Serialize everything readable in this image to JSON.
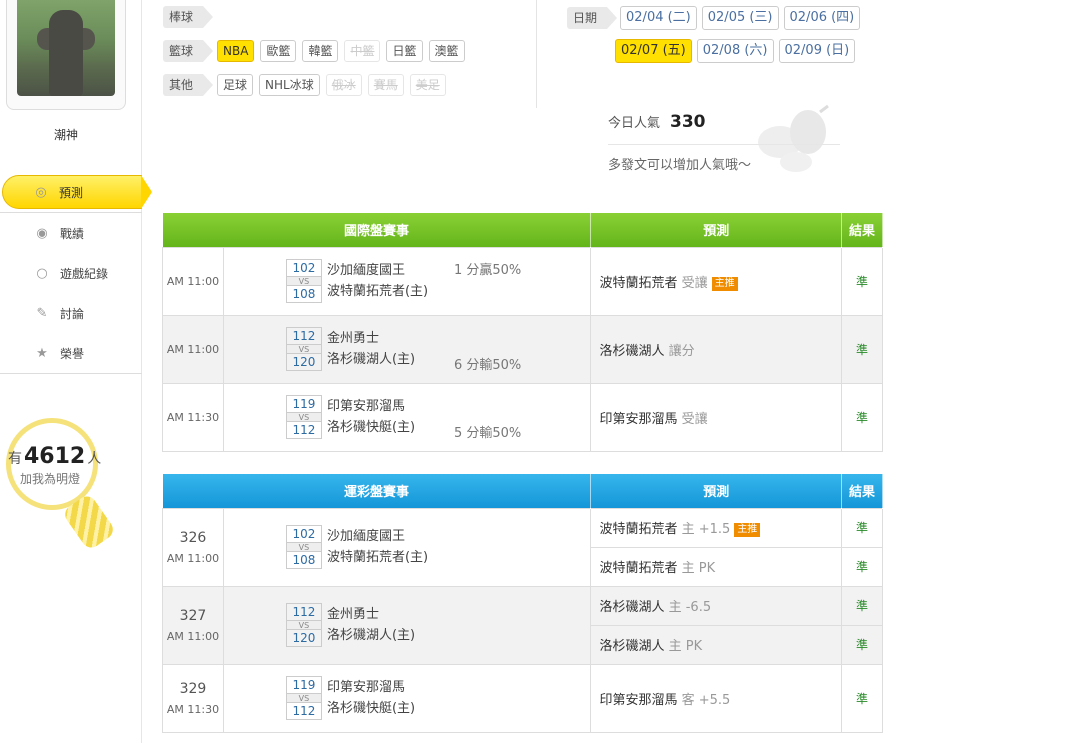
{
  "user": {
    "name": "潮神"
  },
  "nav": [
    {
      "label": "預測",
      "icon": "target-icon",
      "glyph": "◎",
      "active": true
    },
    {
      "label": "戰績",
      "icon": "record-icon",
      "glyph": "◉",
      "active": false
    },
    {
      "label": "遊戲紀錄",
      "icon": "circle-icon",
      "glyph": "○",
      "active": false
    },
    {
      "label": "討論",
      "icon": "chat-icon",
      "glyph": "✎",
      "active": false
    },
    {
      "label": "榮譽",
      "icon": "medal-icon",
      "glyph": "★",
      "active": false
    }
  ],
  "lamp": {
    "prefix": "有",
    "count": "4612",
    "suffix": "人",
    "label": "加我為明燈"
  },
  "filters": {
    "baseball": {
      "label": "棒球",
      "options": []
    },
    "basketball": {
      "label": "籃球",
      "options": [
        {
          "label": "NBA",
          "state": "active"
        },
        {
          "label": "歐籃",
          "state": "normal"
        },
        {
          "label": "韓籃",
          "state": "normal"
        },
        {
          "label": "中籃",
          "state": "disabled"
        },
        {
          "label": "日籃",
          "state": "normal"
        },
        {
          "label": "澳籃",
          "state": "normal"
        }
      ]
    },
    "other": {
      "label": "其他",
      "options": [
        {
          "label": "足球",
          "state": "normal"
        },
        {
          "label": "NHL冰球",
          "state": "normal"
        },
        {
          "label": "俄冰",
          "state": "disabled"
        },
        {
          "label": "賽馬",
          "state": "disabled"
        },
        {
          "label": "美足",
          "state": "disabled"
        }
      ]
    }
  },
  "dates": {
    "label": "日期",
    "row1": [
      "02/04 (二)",
      "02/05 (三)",
      "02/06 (四)"
    ],
    "row2": [
      "02/07 (五)",
      "02/08 (六)",
      "02/09 (日)"
    ],
    "active": "02/07 (五)"
  },
  "popularity": {
    "label": "今日人氣",
    "value": "330",
    "tip": "多發文可以增加人氣哦～"
  },
  "intl": {
    "headers": [
      "國際盤賽事",
      "預測",
      "結果"
    ],
    "rows": [
      {
        "time": "AM 11:00",
        "away_score": "102",
        "away": "沙加緬度國王",
        "home_score": "108",
        "home": "波特蘭拓荒者(主)",
        "vs": "VS",
        "odds": "1 分贏50%",
        "odds_row": "away",
        "pick": "波特蘭拓荒者",
        "pick_sub": "受讓",
        "badge": "主推",
        "result": "準"
      },
      {
        "time": "AM 11:00",
        "away_score": "112",
        "away": "金州勇士",
        "home_score": "120",
        "home": "洛杉磯湖人(主)",
        "vs": "VS",
        "odds": "6 分輸50%",
        "odds_row": "home",
        "pick": "洛杉磯湖人",
        "pick_sub": "讓分",
        "badge": "",
        "result": "準"
      },
      {
        "time": "AM 11:30",
        "away_score": "119",
        "away": "印第安那溜馬",
        "home_score": "112",
        "home": "洛杉磯快艇(主)",
        "vs": "VS",
        "odds": "5 分輸50%",
        "odds_row": "home",
        "pick": "印第安那溜馬",
        "pick_sub": "受讓",
        "badge": "",
        "result": "準"
      }
    ]
  },
  "lottery": {
    "headers": [
      "運彩盤賽事",
      "預測",
      "結果"
    ],
    "rows": [
      {
        "num": "326",
        "time": "AM 11:00",
        "away_score": "102",
        "away": "沙加緬度國王",
        "home_score": "108",
        "home": "波特蘭拓荒者(主)",
        "vs": "VS",
        "picks": [
          {
            "team": "波特蘭拓荒者",
            "sub": "主 +1.5",
            "badge": "主推",
            "result": "準"
          },
          {
            "team": "波特蘭拓荒者",
            "sub": "主 PK",
            "badge": "",
            "result": "準"
          }
        ]
      },
      {
        "num": "327",
        "time": "AM 11:00",
        "away_score": "112",
        "away": "金州勇士",
        "home_score": "120",
        "home": "洛杉磯湖人(主)",
        "vs": "VS",
        "picks": [
          {
            "team": "洛杉磯湖人",
            "sub": "主 -6.5",
            "badge": "",
            "result": "準"
          },
          {
            "team": "洛杉磯湖人",
            "sub": "主 PK",
            "badge": "",
            "result": "準"
          }
        ]
      },
      {
        "num": "329",
        "time": "AM 11:30",
        "away_score": "119",
        "away": "印第安那溜馬",
        "home_score": "112",
        "home": "洛杉磯快艇(主)",
        "vs": "VS",
        "picks": [
          {
            "team": "印第安那溜馬",
            "sub": "客 +5.5",
            "badge": "",
            "result": "準"
          }
        ]
      }
    ]
  },
  "colors": {
    "accent_yellow": "#ffe000",
    "intl_header": "#63b51a",
    "lottery_header": "#1496d8",
    "result_green": "#2a8a2a",
    "badge_orange": "#f08c00"
  }
}
